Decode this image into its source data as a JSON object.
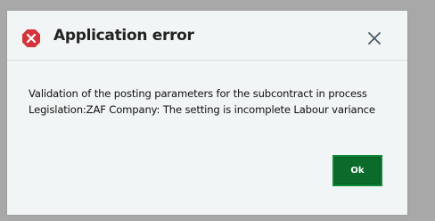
{
  "dialog": {
    "title": "Application error",
    "message_line1": "Validation of the posting parameters for the subcontract in process",
    "message_line2": "Legislation:ZAF Company: The setting is incomplete Labour variance",
    "ok_label": "Ok",
    "close_icon": "close-icon",
    "error_icon": "error-icon"
  },
  "colors": {
    "error_red": "#d4343c",
    "ok_green": "#0b6b2a",
    "dialog_bg": "#f1f5f5"
  }
}
